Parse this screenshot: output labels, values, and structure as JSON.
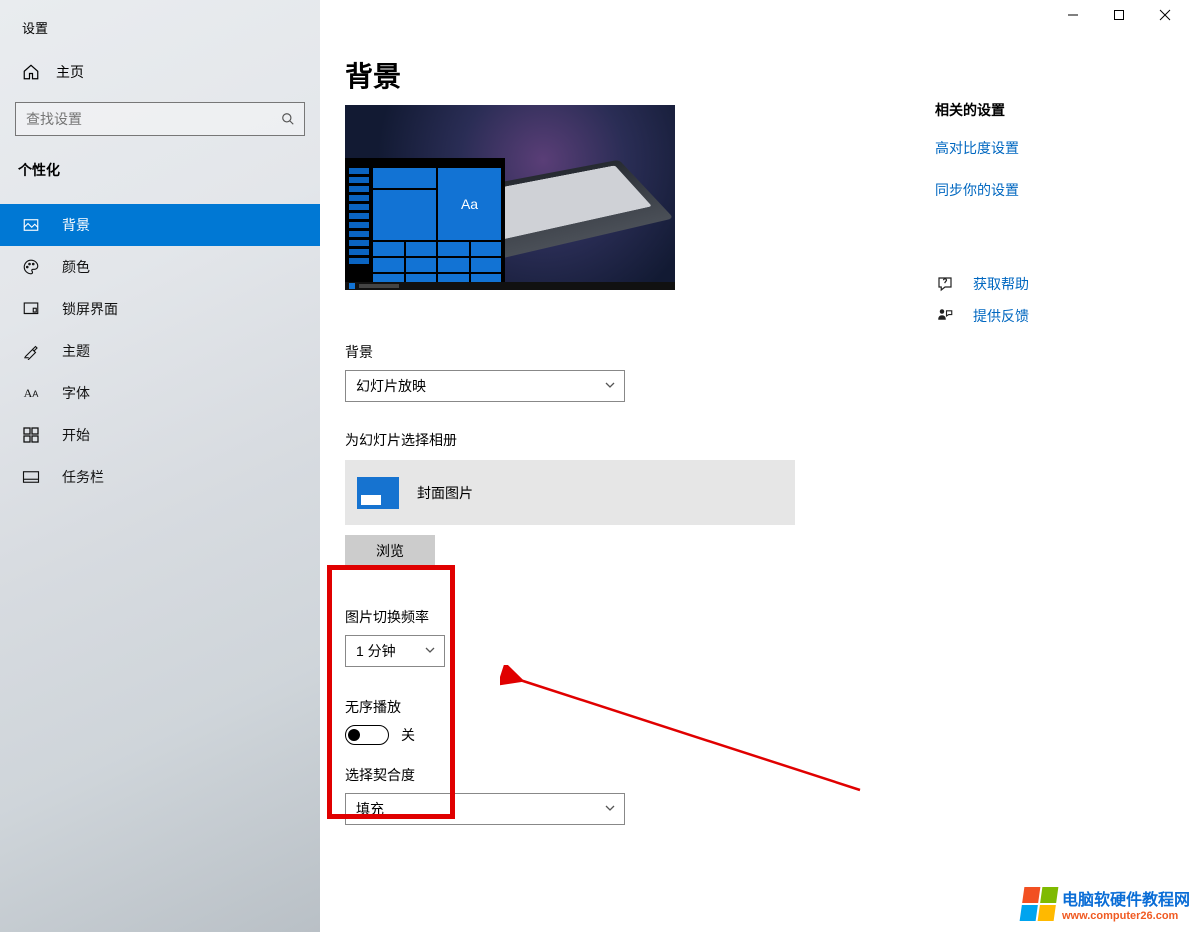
{
  "app_label": "设置",
  "titlebar": {
    "minimize": "最小化",
    "maximize": "最大化",
    "close": "关闭"
  },
  "home_label": "主页",
  "search_placeholder": "查找设置",
  "category_label": "个性化",
  "nav": [
    {
      "key": "background",
      "label": "背景",
      "active": true
    },
    {
      "key": "colors",
      "label": "颜色"
    },
    {
      "key": "lockscreen",
      "label": "锁屏界面"
    },
    {
      "key": "themes",
      "label": "主题"
    },
    {
      "key": "fonts",
      "label": "字体"
    },
    {
      "key": "start",
      "label": "开始"
    },
    {
      "key": "taskbar",
      "label": "任务栏"
    }
  ],
  "page_title": "背景",
  "preview_tile_text": "Aa",
  "fields": {
    "background_label": "背景",
    "background_value": "幻灯片放映",
    "album_label": "为幻灯片选择相册",
    "album_name": "封面图片",
    "browse_button": "浏览",
    "interval_label": "图片切换频率",
    "interval_value": "1 分钟",
    "shuffle_label": "无序播放",
    "shuffle_state_text": "关",
    "fit_label": "选择契合度",
    "fit_value": "填充"
  },
  "right": {
    "heading": "相关的设置",
    "link_high_contrast": "高对比度设置",
    "link_sync": "同步你的设置",
    "link_help": "获取帮助",
    "link_feedback": "提供反馈"
  },
  "watermark": {
    "line1": "电脑软硬件教程网",
    "line2": "www.computer26.com"
  }
}
